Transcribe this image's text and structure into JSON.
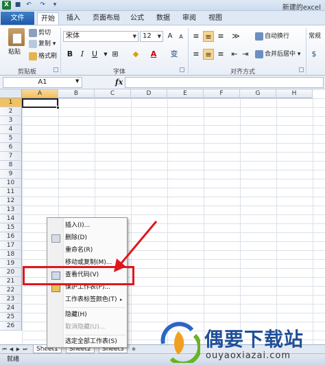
{
  "window": {
    "title": "新建的excel"
  },
  "tabs": [
    "文件",
    "开始",
    "插入",
    "页面布局",
    "公式",
    "数据",
    "审阅",
    "视图"
  ],
  "ribbon": {
    "clipboard": {
      "paste": "粘贴",
      "cut": "剪切",
      "copy": "复制",
      "format_painter": "格式刷",
      "label": "剪贴板"
    },
    "font": {
      "name": "宋体",
      "size": "12",
      "bold": "B",
      "italic": "I",
      "underline": "U",
      "font_color_glyph": "A",
      "pinyin": "变",
      "grow": "A",
      "shrink": "A",
      "label": "字体"
    },
    "alignment": {
      "wrap_text": "自动换行",
      "merge_center": "合并后居中",
      "label": "对齐方式"
    },
    "number": {
      "format": "常规"
    }
  },
  "formula_bar": {
    "name_box": "A1",
    "fx": "fx",
    "value": ""
  },
  "grid": {
    "columns": [
      "A",
      "B",
      "C",
      "D",
      "E",
      "F",
      "G",
      "H"
    ],
    "rows": [
      "1",
      "2",
      "3",
      "4",
      "5",
      "6",
      "7",
      "8",
      "9",
      "10",
      "11",
      "12",
      "13",
      "14",
      "15",
      "16",
      "17",
      "18",
      "19",
      "20",
      "21",
      "22",
      "23",
      "24",
      "25",
      "26"
    ],
    "active_cell": "A1"
  },
  "context_menu": {
    "items": [
      {
        "label": "插入(I)...",
        "disabled": false
      },
      {
        "label": "删除(D)",
        "disabled": false
      },
      {
        "label": "重命名(R)",
        "disabled": false
      },
      {
        "label": "移动或复制(M)...",
        "disabled": false
      },
      {
        "label": "查看代码(V)",
        "disabled": false
      },
      {
        "label": "保护工作表(P)...",
        "disabled": false
      },
      {
        "label": "工作表标签颜色(T)",
        "disabled": false
      },
      {
        "label": "隐藏(H)",
        "disabled": false
      },
      {
        "label": "取消隐藏(U)...",
        "disabled": true
      },
      {
        "label": "选定全部工作表(S)",
        "disabled": false
      }
    ],
    "submenu_arrow": "▸"
  },
  "sheets": [
    "Sheet1",
    "Sheet2",
    "Sheet3"
  ],
  "status": {
    "text": "就绪"
  },
  "watermark": {
    "brand": "偶要下载站",
    "url": "ouyaoxiazai.com"
  },
  "colors": {
    "accent": "#1f5aa6",
    "highlight": "#e0161c",
    "brand": "#1f4f99"
  }
}
